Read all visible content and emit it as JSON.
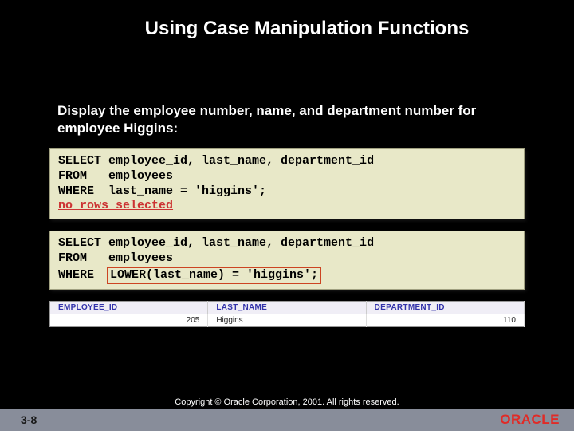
{
  "title": "Using Case Manipulation Functions",
  "subtitle": "Display the employee number, name, and department number for employee Higgins:",
  "code1": {
    "line1": "SELECT employee_id, last_name, department_id",
    "line2": "FROM   employees",
    "line3": "WHERE  last_name = 'higgins';",
    "norows": "no rows selected"
  },
  "code2": {
    "line1": "SELECT employee_id, last_name, department_id",
    "line2": "FROM   employees",
    "line3prefix": "WHERE  ",
    "line3expr": "LOWER(last_name) = 'higgins';"
  },
  "table": {
    "headers": [
      "EMPLOYEE_ID",
      "LAST_NAME",
      "DEPARTMENT_ID"
    ],
    "row": {
      "emp_id": "205",
      "last_name": "Higgins",
      "dept_id": "110"
    }
  },
  "page_num": "3-8",
  "copyright": "Copyright © Oracle Corporation, 2001. All rights reserved.",
  "logo_text": "ORACLE"
}
